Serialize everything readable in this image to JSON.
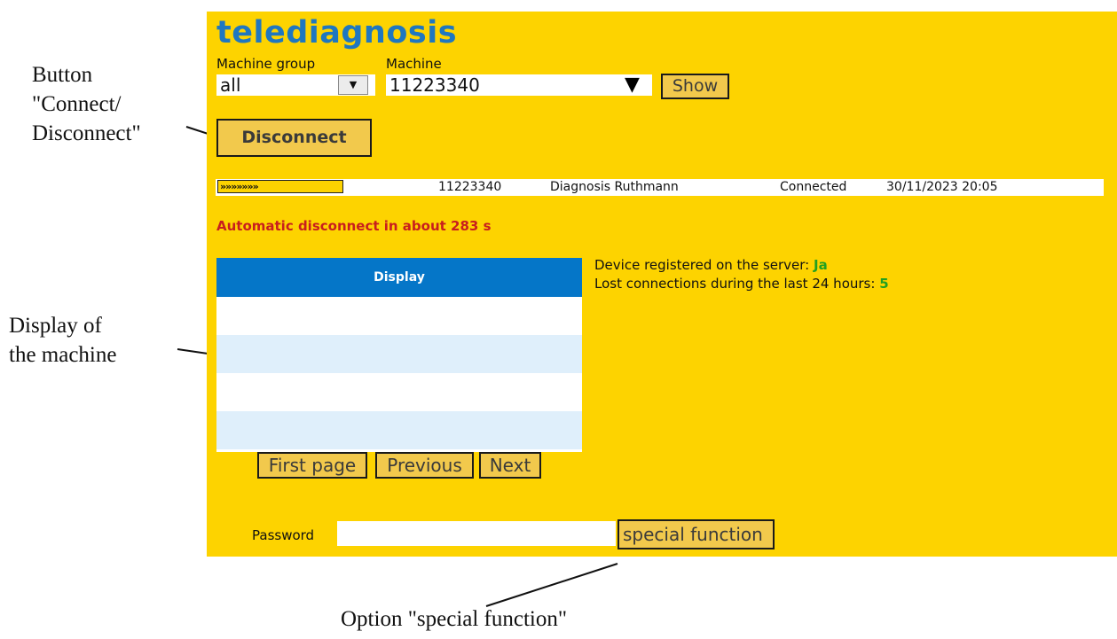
{
  "annotations": {
    "connect_button": [
      "Button",
      "\"Connect/",
      "Disconnect\""
    ],
    "display": [
      "Display of",
      "the machine"
    ],
    "special_function": "Option \"special function\""
  },
  "app": {
    "title": "telediagnosis",
    "machine_group_label": "Machine group",
    "machine_group_value": "all",
    "machine_label": "Machine",
    "machine_value": "11223340",
    "show_label": "Show",
    "disconnect_label": "Disconnect"
  },
  "status_row": {
    "progress_glyphs": "»»»»»»»",
    "machine_id": "11223340",
    "name": "Diagnosis Ruthmann",
    "state": "Connected",
    "timestamp": "30/11/2023 20:05"
  },
  "auto_disconnect": "Automatic disconnect in about 283 s",
  "display": {
    "header": "Display"
  },
  "device_info": {
    "registered_label": "Device registered on the server: ",
    "registered_value": "Ja",
    "lost_label": "Lost connections during the last 24 hours: ",
    "lost_value": "5"
  },
  "pager": {
    "first": "First page",
    "previous": "Previous",
    "next": "Next"
  },
  "password": {
    "label": "Password",
    "value": "",
    "special_label": "special function"
  },
  "colors": {
    "panel_background": "#fdd300",
    "title": "#1f77c0",
    "display_header": "#0576c8",
    "warning_text": "#c81e1e",
    "ok_value": "#21a021"
  }
}
